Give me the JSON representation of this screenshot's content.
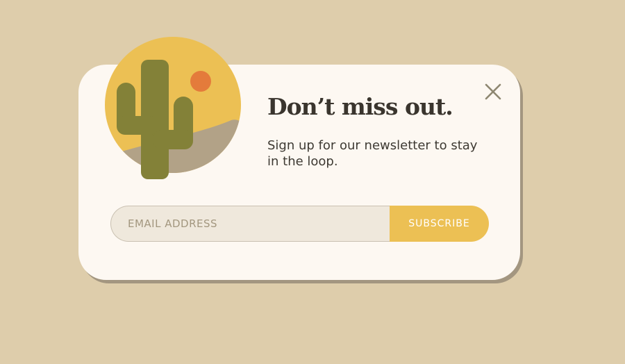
{
  "popup": {
    "headline": "Don’t miss out.",
    "subtext": "Sign up for our newsletter to stay in the loop.",
    "email_placeholder": "EMAIL ADDRESS",
    "email_value": "",
    "subscribe_label": "SUBSCRIBE",
    "close_icon": "close-icon",
    "illustration_icon": "desert-cactus-illustration"
  },
  "colors": {
    "page_background": "#decdab",
    "card_background": "#fdf8f2",
    "card_shadow": "#a39680",
    "accent_yellow": "#ecc054",
    "sun_orange": "#e47b3b",
    "cactus_green": "#838138",
    "hill_taupe": "#b2a287",
    "heading_text": "#3a352e",
    "close_icon": "#8e8771"
  }
}
